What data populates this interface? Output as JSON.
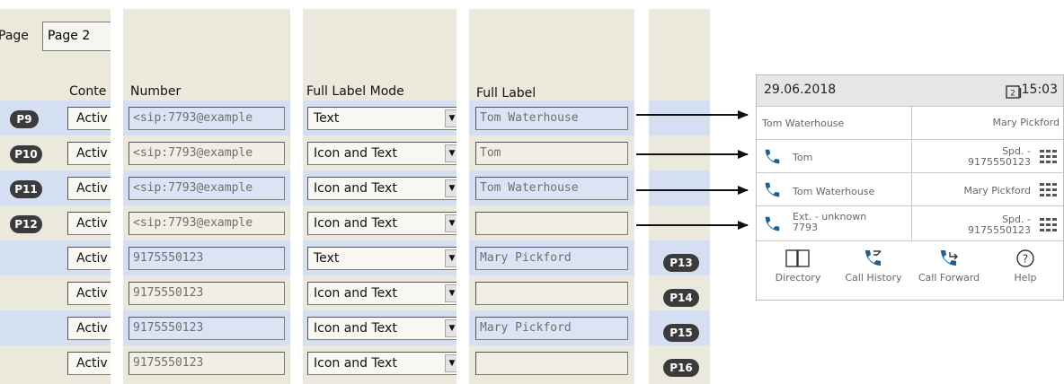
{
  "config": {
    "page_tab_partial": "Page",
    "page_tab_value": "Page 2",
    "headers": {
      "content": "Conte",
      "number": "Number",
      "full_label_mode": "Full Label Mode",
      "full_label": "Full Label"
    },
    "rows": [
      {
        "key": "P9",
        "content": "Activ",
        "number": "<sip:7793@example",
        "mode": "Text",
        "label": "Tom Waterhouse",
        "key_right": ""
      },
      {
        "key": "P10",
        "content": "Activ",
        "number": "<sip:7793@example",
        "mode": "Icon and Text",
        "label": "Tom",
        "key_right": ""
      },
      {
        "key": "P11",
        "content": "Activ",
        "number": "<sip:7793@example",
        "mode": "Icon and Text",
        "label": "Tom Waterhouse",
        "key_right": ""
      },
      {
        "key": "P12",
        "content": "Activ",
        "number": "<sip:7793@example",
        "mode": "Icon and Text",
        "label": "",
        "key_right": ""
      },
      {
        "key": "",
        "content": "Activ",
        "number": "9175550123",
        "mode": "Text",
        "label": "Mary Pickford",
        "key_right": "P13"
      },
      {
        "key": "",
        "content": "Activ",
        "number": "9175550123",
        "mode": "Icon and Text",
        "label": "",
        "key_right": "P14"
      },
      {
        "key": "",
        "content": "Activ",
        "number": "9175550123",
        "mode": "Icon and Text",
        "label": "Mary Pickford",
        "key_right": "P15"
      },
      {
        "key": "",
        "content": "Activ",
        "number": "9175550123",
        "mode": "Icon and Text",
        "label": "",
        "key_right": "P16"
      }
    ],
    "dropdown_icon": "triangle-down"
  },
  "phone": {
    "date": "29.06.2018",
    "calendar_day": "2",
    "time": "15:03",
    "rows": [
      {
        "left": "Tom Waterhouse",
        "left_sub": "",
        "left_icon": "",
        "right": "Mary Pickford",
        "right_sub": "",
        "right_icon": ""
      },
      {
        "left": "Tom",
        "left_sub": "",
        "left_icon": "handset-icon",
        "right": "Spd. -",
        "right_sub": "9175550123",
        "right_icon": "keypad-icon"
      },
      {
        "left": "Tom Waterhouse",
        "left_sub": "",
        "left_icon": "handset-icon",
        "right": "Mary Pickford",
        "right_sub": "",
        "right_icon": "keypad-icon"
      },
      {
        "left": "Ext. - unknown",
        "left_sub": "7793",
        "left_icon": "handset-icon",
        "right": "Spd. -",
        "right_sub": "9175550123",
        "right_icon": "keypad-icon"
      }
    ],
    "footer": [
      {
        "label": "Directory",
        "icon": "book-icon"
      },
      {
        "label": "Call History",
        "icon": "call-history-icon"
      },
      {
        "label": "Call Forward",
        "icon": "call-forward-icon"
      },
      {
        "label": "Help",
        "icon": "help-icon"
      }
    ]
  },
  "colors": {
    "band_blue": "#d4dff2",
    "background_beige": "#ebe8dc",
    "pill": "#3b3b3b",
    "phone_icon": "#1f6090"
  }
}
